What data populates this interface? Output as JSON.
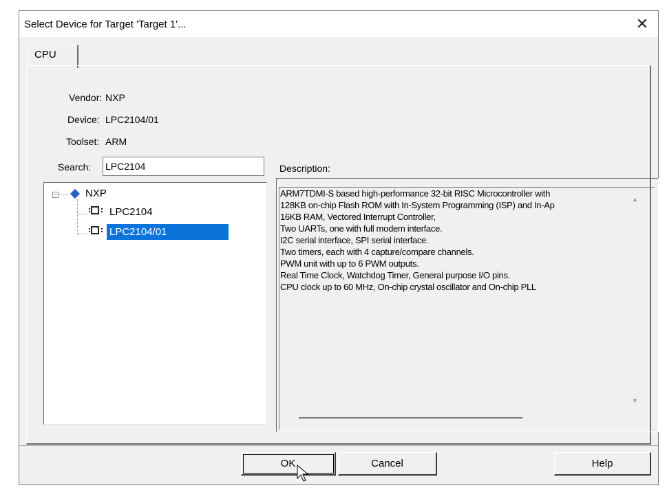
{
  "dialog": {
    "title": "Select Device for Target 'Target 1'...",
    "close_glyph": "✕"
  },
  "tabs": [
    {
      "label": "CPU"
    }
  ],
  "info": {
    "vendor_label": "Vendor:",
    "vendor_value": "NXP",
    "device_label": "Device:",
    "device_value": "LPC2104/01",
    "toolset_label": "Toolset:",
    "toolset_value": "ARM"
  },
  "search": {
    "label": "Search:",
    "value": "LPC2104"
  },
  "tree": {
    "expander_glyph": "−",
    "vendor": {
      "label": "NXP",
      "icon": "vendor-diamond-icon"
    },
    "devices": [
      {
        "label": "LPC2104",
        "icon": "chip-icon",
        "selected": false
      },
      {
        "label": "LPC2104/01",
        "icon": "chip-icon",
        "selected": true
      }
    ]
  },
  "description": {
    "label": "Description:",
    "lines": [
      "ARM7TDMI-S based high-performance 32-bit RISC Microcontroller with",
      "128KB on-chip Flash ROM with In-System Programming (ISP) and In-Ap",
      "16KB RAM, Vectored Interrupt Controller,",
      "Two UARTs, one with full modem interface.",
      "I2C serial interface, SPI serial interface.",
      "Two timers, each with 4 capture/compare channels.",
      "PWM unit with up to 6 PWM outputs.",
      "Real Time Clock, Watchdog Timer, General purpose I/O pins.",
      "CPU clock up to 60 MHz, On-chip crystal oscillator and On-chip PLL"
    ],
    "scroll_up_glyph": "▲",
    "scroll_down_glyph": "▼"
  },
  "buttons": {
    "ok": "OK",
    "cancel": "Cancel",
    "help": "Help"
  },
  "colors": {
    "selection": "#0a74da",
    "dialog_bg": "#f0f0f0",
    "vendor_icon": "#2a5fc8"
  }
}
